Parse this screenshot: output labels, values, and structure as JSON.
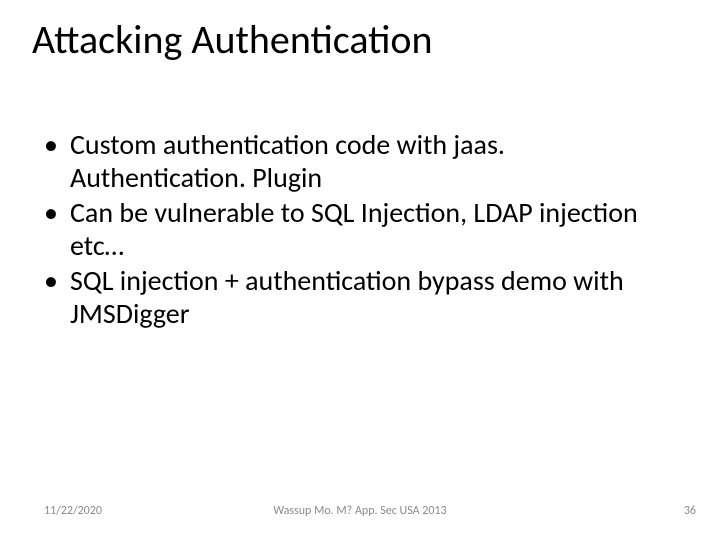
{
  "slide": {
    "title": "Attacking Authentication",
    "bullets": [
      "Custom authentication code with jaas. Authentication. Plugin",
      "Can be vulnerable to SQL Injection, LDAP injection etc…",
      "SQL injection + authentication bypass demo with JMSDigger"
    ],
    "footer": {
      "date": "11/22/2020",
      "center": "Wassup Mo. M? App. Sec USA 2013",
      "page": "36"
    }
  }
}
